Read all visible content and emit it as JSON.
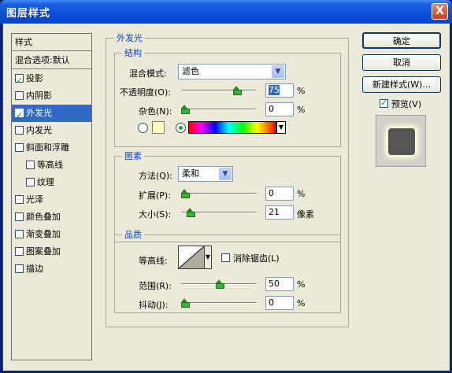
{
  "window": {
    "title": "图层样式",
    "close_label": "X"
  },
  "styles_list": {
    "header": "样式",
    "blend_default": "混合选项:默认",
    "items": [
      {
        "label": "投影",
        "checked": true,
        "indent": false,
        "selected": false
      },
      {
        "label": "内阴影",
        "checked": false,
        "indent": false,
        "selected": false
      },
      {
        "label": "外发光",
        "checked": true,
        "indent": false,
        "selected": true
      },
      {
        "label": "内发光",
        "checked": false,
        "indent": false,
        "selected": false
      },
      {
        "label": "斜面和浮雕",
        "checked": false,
        "indent": false,
        "selected": false
      },
      {
        "label": "等高线",
        "checked": false,
        "indent": true,
        "selected": false
      },
      {
        "label": "纹理",
        "checked": false,
        "indent": true,
        "selected": false
      },
      {
        "label": "光泽",
        "checked": false,
        "indent": false,
        "selected": false
      },
      {
        "label": "颜色叠加",
        "checked": false,
        "indent": false,
        "selected": false
      },
      {
        "label": "渐变叠加",
        "checked": false,
        "indent": false,
        "selected": false
      },
      {
        "label": "图案叠加",
        "checked": false,
        "indent": false,
        "selected": false
      },
      {
        "label": "描边",
        "checked": false,
        "indent": false,
        "selected": false
      }
    ]
  },
  "outer_glow": {
    "section_title": "外发光",
    "structure": {
      "title": "结构",
      "blend_mode_label": "混合模式:",
      "blend_mode_value": "滤色",
      "opacity_label": "不透明度(O):",
      "opacity_value": "75",
      "opacity_unit": "%",
      "noise_label": "杂色(N):",
      "noise_value": "0",
      "noise_unit": "%",
      "glow_color": "#ffffbe"
    },
    "elements": {
      "title": "图素",
      "method_label": "方法(Q):",
      "method_value": "柔和",
      "spread_label": "扩展(P):",
      "spread_value": "0",
      "spread_unit": "%",
      "size_label": "大小(S):",
      "size_value": "21",
      "size_unit": "像素"
    },
    "quality": {
      "title": "品质",
      "contour_label": "等高线:",
      "antialias_label": "消除锯齿(L)",
      "antialias_checked": false,
      "range_label": "范围(R):",
      "range_value": "50",
      "range_unit": "%",
      "jitter_label": "抖动(J):",
      "jitter_value": "0",
      "jitter_unit": "%"
    }
  },
  "buttons": {
    "ok": "确定",
    "cancel": "取消",
    "new_style": "新建样式(W)..."
  },
  "preview": {
    "label": "预览(V)",
    "checked": true
  }
}
